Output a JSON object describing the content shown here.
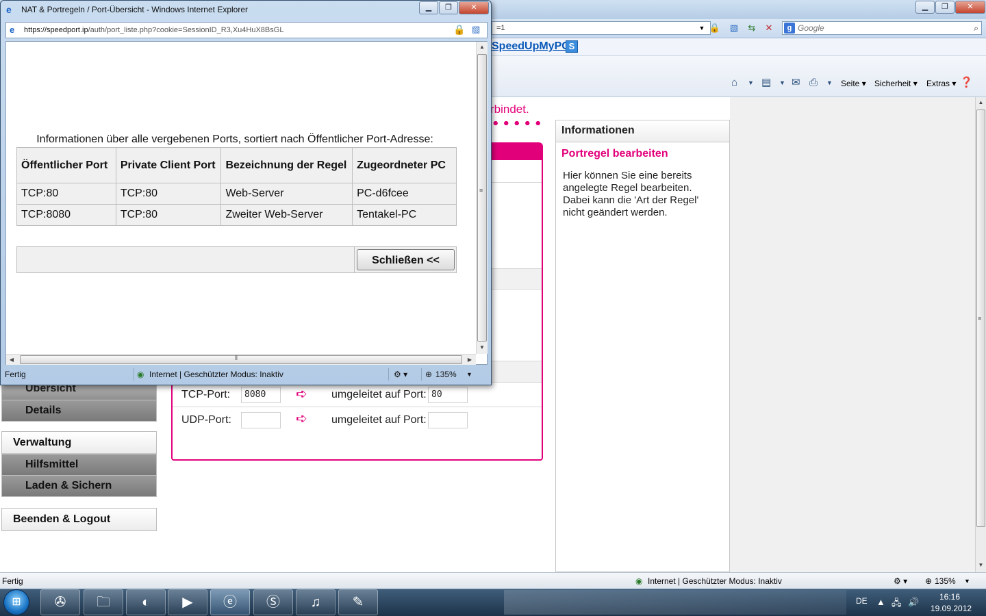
{
  "popup": {
    "title": "NAT & Portregeln / Port-Übersicht - Windows Internet Explorer",
    "url_main": "https://speedport.ip",
    "url_rest": "/auth/port_liste.php?cookie=SessionID_R3,Xu4HuX8BsGL",
    "caption": "Informationen über alle vergebenen Ports, sortiert nach Öffentlicher Port-Adresse:",
    "table": {
      "headers": [
        "Öffentlicher Port",
        "Private Client Port",
        "Bezeichnung der Regel",
        "Zugeordneter PC"
      ],
      "rows": [
        [
          "TCP:80",
          "TCP:80",
          "Web-Server",
          "PC-d6fcee"
        ],
        [
          "TCP:8080",
          "TCP:80",
          "Zweiter Web-Server",
          "Tentakel-PC"
        ]
      ]
    },
    "close_label": "Schließen <<",
    "status": {
      "text": "Fertig",
      "zone": "Internet | Geschützter Modus: Inaktiv",
      "zoom": "135%"
    }
  },
  "background": {
    "address_fragment": "=1",
    "search_placeholder": "Google",
    "favorite_link": "SpeedUpMyPC",
    "favorite_badge": "S",
    "commands": {
      "page": "Seite",
      "security": "Sicherheit",
      "extras": "Extras"
    },
    "connection_text": "rbindet.",
    "info_panel": {
      "title": "Informationen",
      "subtitle": "Portregel bearbeiten",
      "text": "Hier können Sie eine bereits angelegte Regel bearbeiten. Dabei kann die 'Art der Regel' nicht geändert werden."
    },
    "ports": {
      "tcp_label": "TCP-Port:",
      "tcp_value": "8080",
      "tcp_redirect_label": "umgeleitet auf Port:",
      "tcp_redirect_value": "80",
      "udp_label": "UDP-Port:",
      "udp_value": "",
      "udp_redirect_label": "umgeleitet auf Port:",
      "udp_redirect_value": ""
    },
    "nav": {
      "partial_item": "Übersicht",
      "details": "Details",
      "admin_head": "Verwaltung",
      "admin_items": [
        "Hilfsmittel",
        "Laden & Sichern"
      ],
      "logout": "Beenden & Logout"
    },
    "status": {
      "text": "Fertig",
      "zone": "Internet | Geschützter Modus: Inaktiv",
      "zoom": "135%"
    }
  },
  "taskbar": {
    "lang": "DE",
    "time": "16:16",
    "date": "19.09.2012"
  },
  "colors": {
    "brand_magenta": "#e2007a",
    "link_blue": "#0a58b8"
  }
}
